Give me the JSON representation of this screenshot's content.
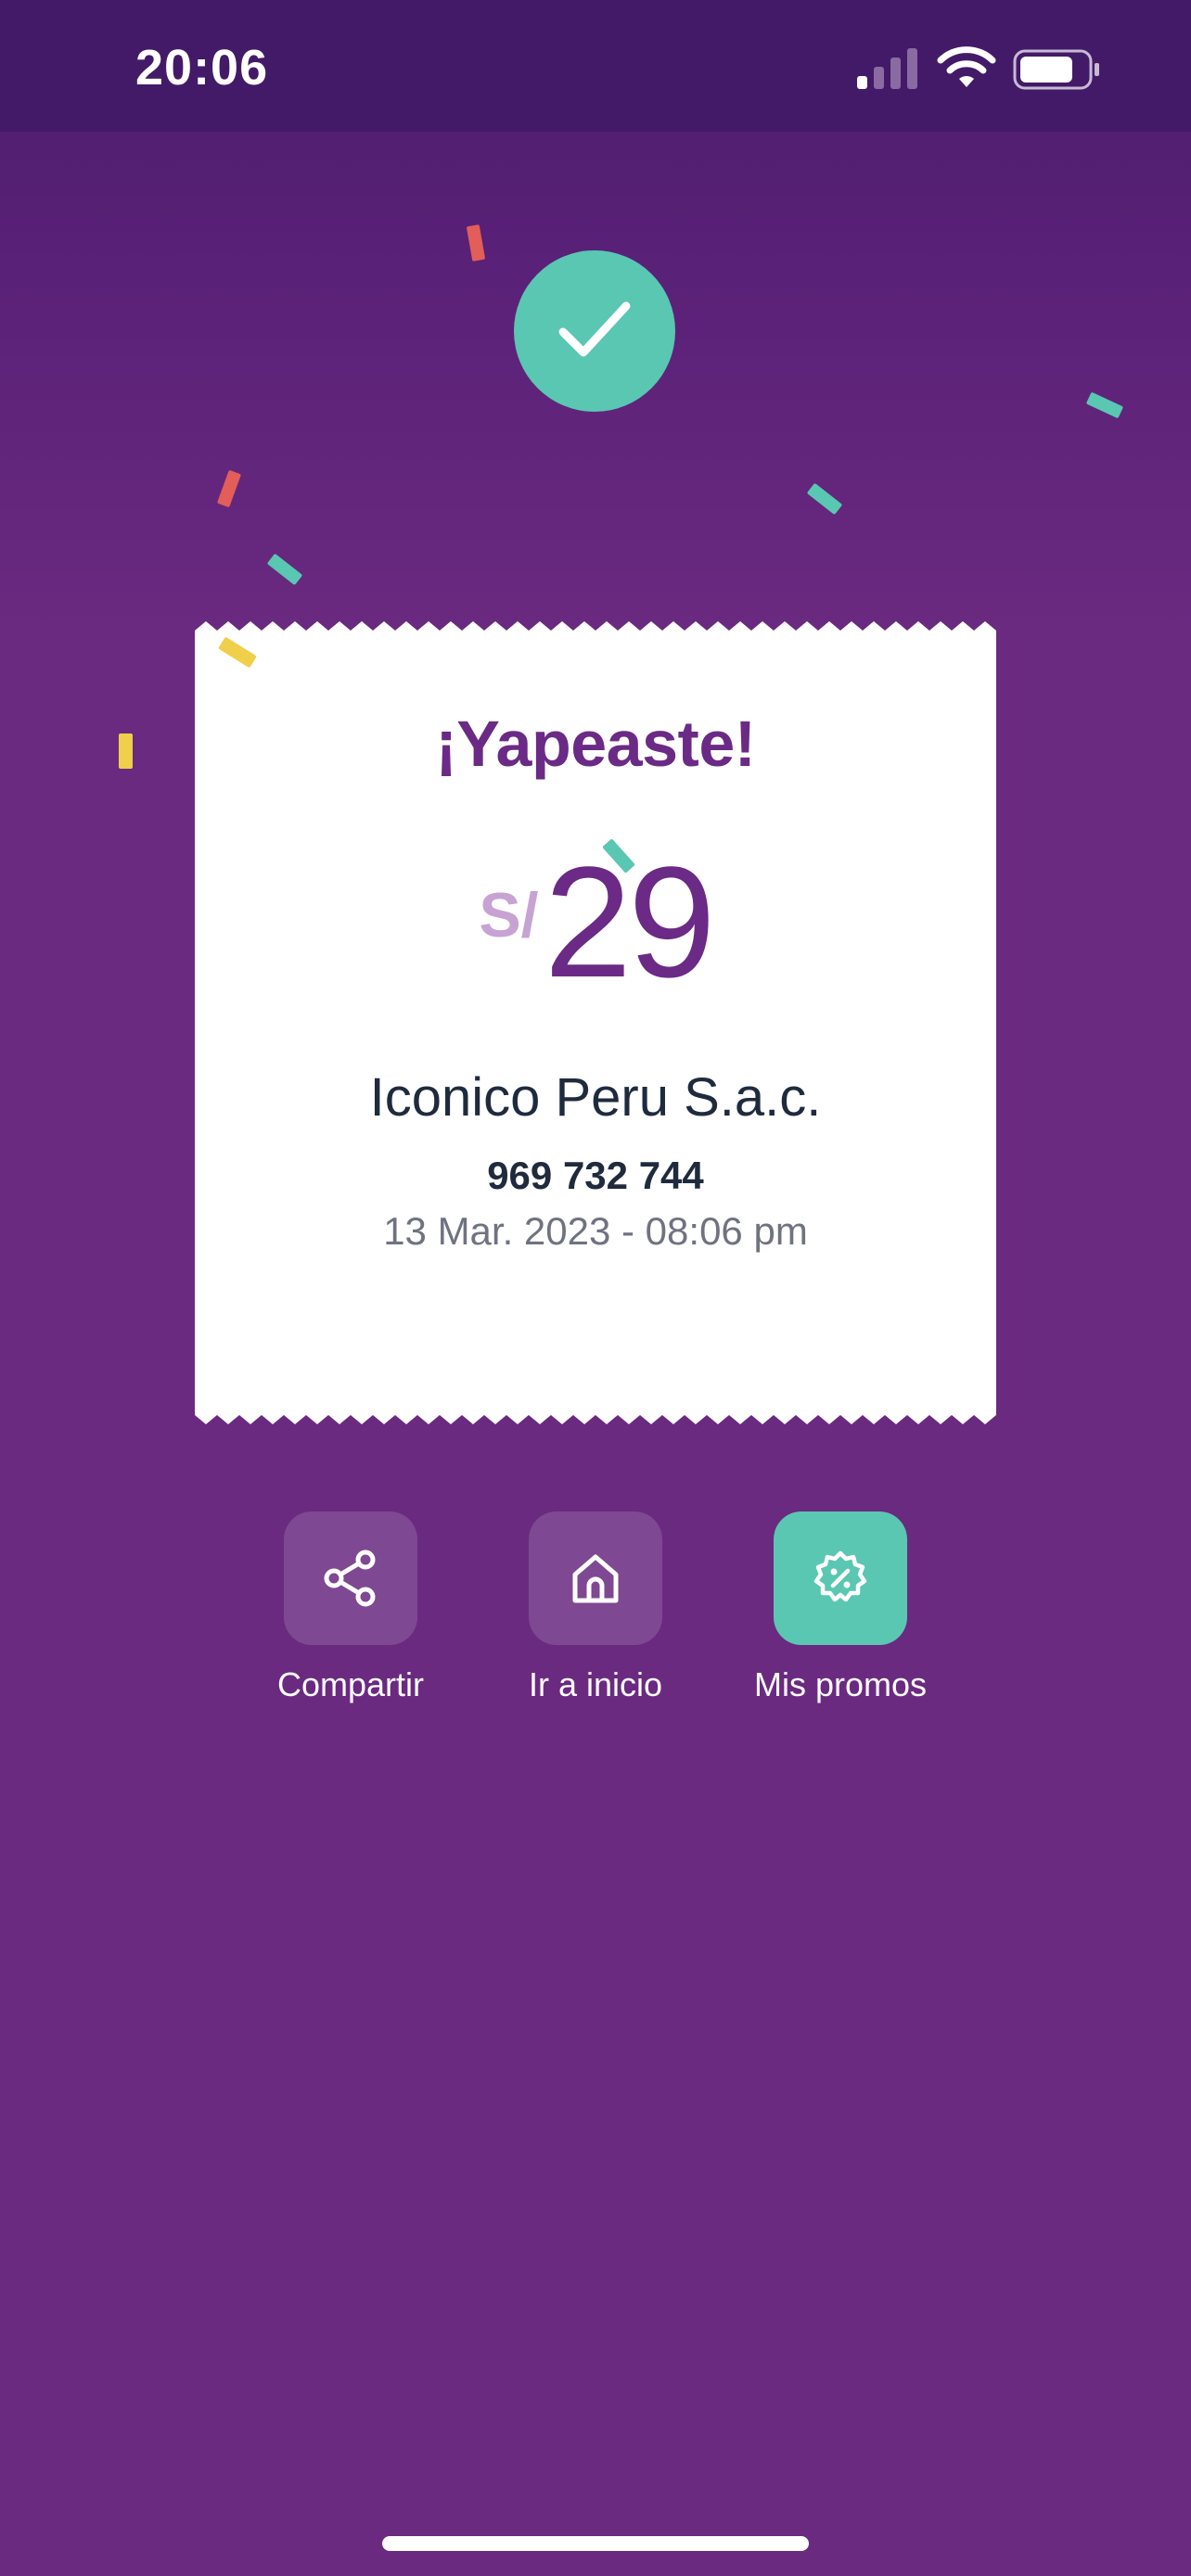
{
  "status_bar": {
    "time": "20:06",
    "signal_icon": "cellular-signal-icon",
    "wifi_icon": "wifi-icon",
    "battery_icon": "battery-icon"
  },
  "success_icon": "checkmark-icon",
  "receipt": {
    "title": "¡Yapeaste!",
    "currency": "S/",
    "amount": "29",
    "merchant": "Iconico Peru S.a.c.",
    "phone": "969 732 744",
    "date": "13 Mar. 2023 - 08:06 pm"
  },
  "actions": [
    {
      "label": "Compartir",
      "icon": "share-icon"
    },
    {
      "label": "Ir a inicio",
      "icon": "home-icon"
    },
    {
      "label": "Mis promos",
      "icon": "promo-badge-icon"
    }
  ],
  "colors": {
    "background": "#6a2a80",
    "status_bar": "#431a68",
    "accent_green": "#5ac7b2",
    "brand_purple": "#6b2a85",
    "currency_lilac": "#c7a3d3"
  }
}
